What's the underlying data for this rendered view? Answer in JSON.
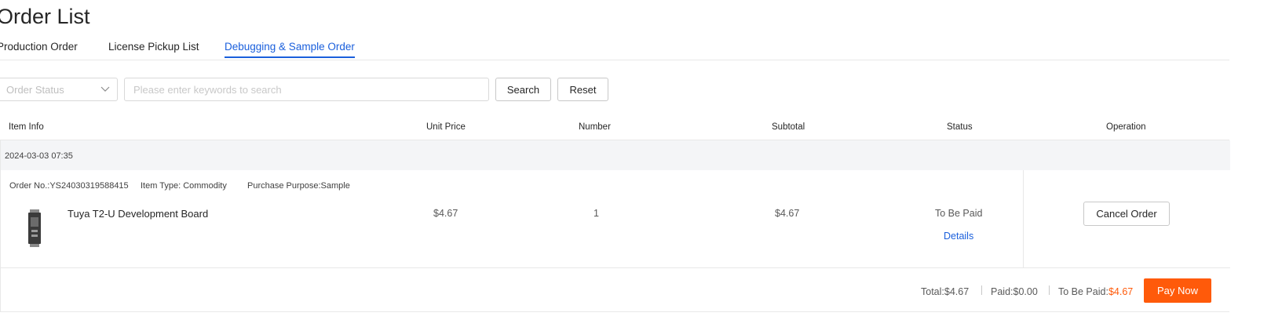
{
  "page": {
    "title": "Order List"
  },
  "tabs": [
    {
      "label": "Production Order",
      "active": false
    },
    {
      "label": "License Pickup List",
      "active": false
    },
    {
      "label": "Debugging & Sample Order",
      "active": true
    }
  ],
  "filters": {
    "status_placeholder": "Order Status",
    "search_placeholder": "Please enter keywords to search",
    "search_label": "Search",
    "reset_label": "Reset"
  },
  "table": {
    "headers": [
      "Item Info",
      "Unit Price",
      "Number",
      "Subtotal",
      "Status",
      "Operation"
    ]
  },
  "order": {
    "date": "2024-03-03 07:35",
    "order_no": "Order No.:YS24030319588415",
    "item_type": "Item Type: Commodity",
    "purpose": "Purchase Purpose:Sample",
    "item_name": "Tuya T2-U Development Board",
    "unit_price": "$4.67",
    "number": "1",
    "subtotal": "$4.67",
    "status": "To Be Paid",
    "details_label": "Details",
    "cancel_label": "Cancel Order"
  },
  "summary": {
    "total_label": "Total:",
    "total": "$4.67",
    "paid_label": "Paid:",
    "paid": "$0.00",
    "due_label": "To Be Paid:",
    "due": "$4.67",
    "pay_label": "Pay Now"
  },
  "colors": {
    "accent": "#1a5fdc",
    "pay": "#ff5a0a"
  },
  "icons": {
    "select": "chevron-down-icon",
    "thumb": "product-thumbnail"
  }
}
